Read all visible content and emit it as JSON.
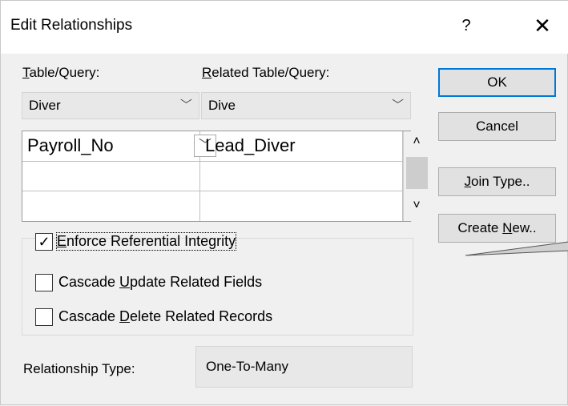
{
  "window": {
    "title": "Edit Relationships",
    "help_glyph": "?",
    "close_glyph": "✕"
  },
  "labels": {
    "table_query_first": "T",
    "table_query_rest": "able/Query:",
    "related_first": "R",
    "related_rest": "elated Table/Query:"
  },
  "selects": {
    "table_value": "Diver",
    "related_value": "Dive"
  },
  "fields": {
    "rows": [
      {
        "left": "Payroll_No",
        "right": "Lead_Diver"
      },
      {
        "left": "",
        "right": ""
      },
      {
        "left": "",
        "right": ""
      }
    ]
  },
  "options": {
    "enforce": {
      "checked": true,
      "first": "E",
      "rest": "nforce Referential Integrity"
    },
    "cascade_update": {
      "checked": false,
      "pre": "Cascade ",
      "key": "U",
      "post": "pdate Related Fields"
    },
    "cascade_delete": {
      "checked": false,
      "pre": "Cascade ",
      "key": "D",
      "post": "elete Related Records"
    }
  },
  "buttons": {
    "ok": "OK",
    "cancel": "Cancel",
    "join_key": "J",
    "join_rest": "oin Type..",
    "create_pre": "Create ",
    "create_key": "N",
    "create_rest": "ew.."
  },
  "relationship_type": {
    "label": "Relationship Type:",
    "value": "One-To-Many"
  },
  "icons": {
    "chevron": "﹀",
    "scroll_up": "˄",
    "scroll_down": "˅",
    "check": "✓"
  }
}
